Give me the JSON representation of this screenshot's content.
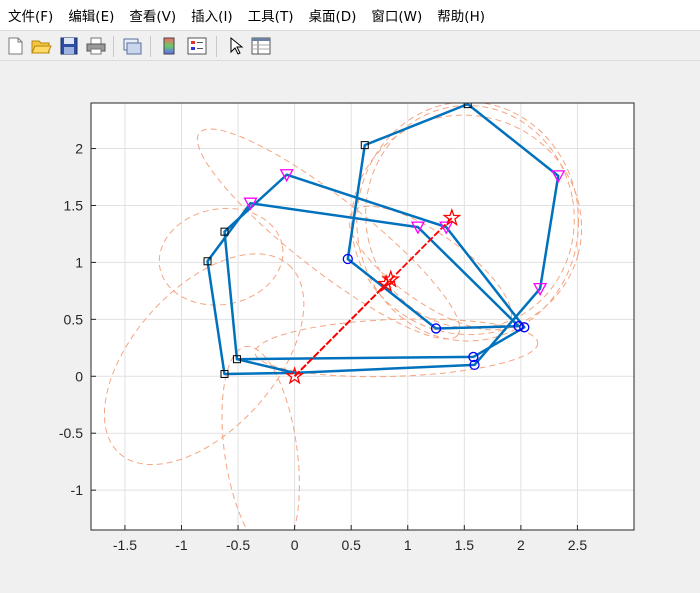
{
  "menu": [
    "文件(F)",
    "编辑(E)",
    "查看(V)",
    "插入(I)",
    "工具(T)",
    "桌面(D)",
    "窗口(W)",
    "帮助(H)"
  ],
  "toolbar": [
    "new-figure-icon",
    "open-folder-icon",
    "save-icon",
    "print-icon",
    "link-plot-icon",
    "colorbar-icon",
    "legend-icon",
    "pointer-icon",
    "property-inspector-icon"
  ],
  "chart_data": {
    "type": "line",
    "xlim": [
      -1.8,
      3.0
    ],
    "ylim": [
      -1.35,
      2.4
    ],
    "xticks": [
      -1.5,
      -1,
      -0.5,
      0,
      0.5,
      1,
      1.5,
      2,
      2.5
    ],
    "yticks": [
      -1,
      -0.5,
      0,
      0.5,
      1,
      1.5,
      2
    ],
    "xtick_labels": [
      "-1.5",
      "-1",
      "-0.5",
      "0",
      "0.5",
      "1",
      "1.5",
      "2",
      "2.5"
    ],
    "ytick_labels": [
      "-1",
      "-0.5",
      "0",
      "0.5",
      "1",
      "1.5",
      "2"
    ],
    "grid": true,
    "colors": {
      "linkage": "#0072bd",
      "trace": "#f4a582",
      "circle": "#0000ff",
      "square": "#000000",
      "triangle": "#ff00ff",
      "star": "#ff0000"
    },
    "series": [
      {
        "kind": "linkage",
        "points": [
          [
            0,
            0.03
          ],
          [
            -0.62,
            0.02
          ],
          [
            -0.77,
            1.01
          ],
          [
            -0.39,
            1.52
          ],
          [
            1.09,
            1.31
          ],
          [
            1.98,
            0.44
          ],
          [
            1.25,
            0.42
          ],
          [
            0.47,
            1.03
          ],
          [
            0.62,
            2.03
          ],
          [
            1.53,
            2.39
          ],
          [
            2.33,
            1.76
          ],
          [
            2.17,
            0.77
          ],
          [
            1.59,
            0.1
          ],
          [
            0,
            0.03
          ]
        ]
      },
      {
        "kind": "linkage",
        "points": [
          [
            0,
            0.03
          ],
          [
            -0.51,
            0.15
          ],
          [
            -0.62,
            1.27
          ],
          [
            -0.07,
            1.77
          ],
          [
            1.34,
            1.31
          ],
          [
            2.03,
            0.43
          ],
          [
            1.58,
            0.17
          ],
          [
            -0.51,
            0.15
          ]
        ]
      },
      {
        "kind": "crank",
        "points": [
          [
            0,
            0.0
          ],
          [
            1.39,
            1.39
          ]
        ]
      },
      {
        "kind": "crank",
        "points": [
          [
            0,
            0.0
          ],
          [
            0.85,
            0.85
          ]
        ]
      },
      {
        "kind": "crank",
        "points": [
          [
            0,
            0.0
          ],
          [
            0.81,
            0.81
          ]
        ]
      }
    ],
    "markers": {
      "circle": [
        [
          0.47,
          1.03
        ],
        [
          1.25,
          0.42
        ],
        [
          1.98,
          0.44
        ],
        [
          2.03,
          0.43
        ],
        [
          1.58,
          0.17
        ],
        [
          1.59,
          0.1
        ]
      ],
      "square": [
        [
          -0.62,
          0.02
        ],
        [
          -0.51,
          0.15
        ],
        [
          -0.77,
          1.01
        ],
        [
          -0.62,
          1.27
        ],
        [
          0.62,
          2.03
        ],
        [
          1.53,
          2.39
        ]
      ],
      "triangle": [
        [
          -0.39,
          1.52
        ],
        [
          -0.07,
          1.77
        ],
        [
          1.09,
          1.31
        ],
        [
          1.34,
          1.31
        ],
        [
          2.33,
          1.76
        ],
        [
          2.17,
          0.77
        ]
      ],
      "star": [
        [
          0,
          0.0
        ],
        [
          0.85,
          0.85
        ],
        [
          0.81,
          0.81
        ],
        [
          1.39,
          1.39
        ]
      ]
    },
    "traces": [
      {
        "cx": 1.53,
        "cy": 1.36,
        "rx": 0.98,
        "ry": 1.05,
        "rot": 0
      },
      {
        "cx": 1.55,
        "cy": 1.4,
        "rx": 0.92,
        "ry": 0.98,
        "rot": 10
      },
      {
        "cx": 1.52,
        "cy": 1.33,
        "rx": 1.02,
        "ry": 0.96,
        "rot": -15
      },
      {
        "cx": -0.8,
        "cy": 0.15,
        "rx": 1.12,
        "ry": 0.62,
        "rot": 48
      },
      {
        "cx": 0.3,
        "cy": 1.25,
        "rx": 1.45,
        "ry": 0.32,
        "rot": -38
      },
      {
        "cx": -0.65,
        "cy": 1.05,
        "rx": 0.55,
        "ry": 0.42,
        "rot": 10
      },
      {
        "cx": -0.3,
        "cy": -0.65,
        "rx": 0.32,
        "ry": 0.92,
        "rot": 8
      },
      {
        "cx": 0.9,
        "cy": 0.25,
        "rx": 1.25,
        "ry": 0.25,
        "rot": 2
      },
      {
        "cx": 1.2,
        "cy": 0.95,
        "rx": 0.85,
        "ry": 0.3,
        "rot": -35
      }
    ]
  }
}
